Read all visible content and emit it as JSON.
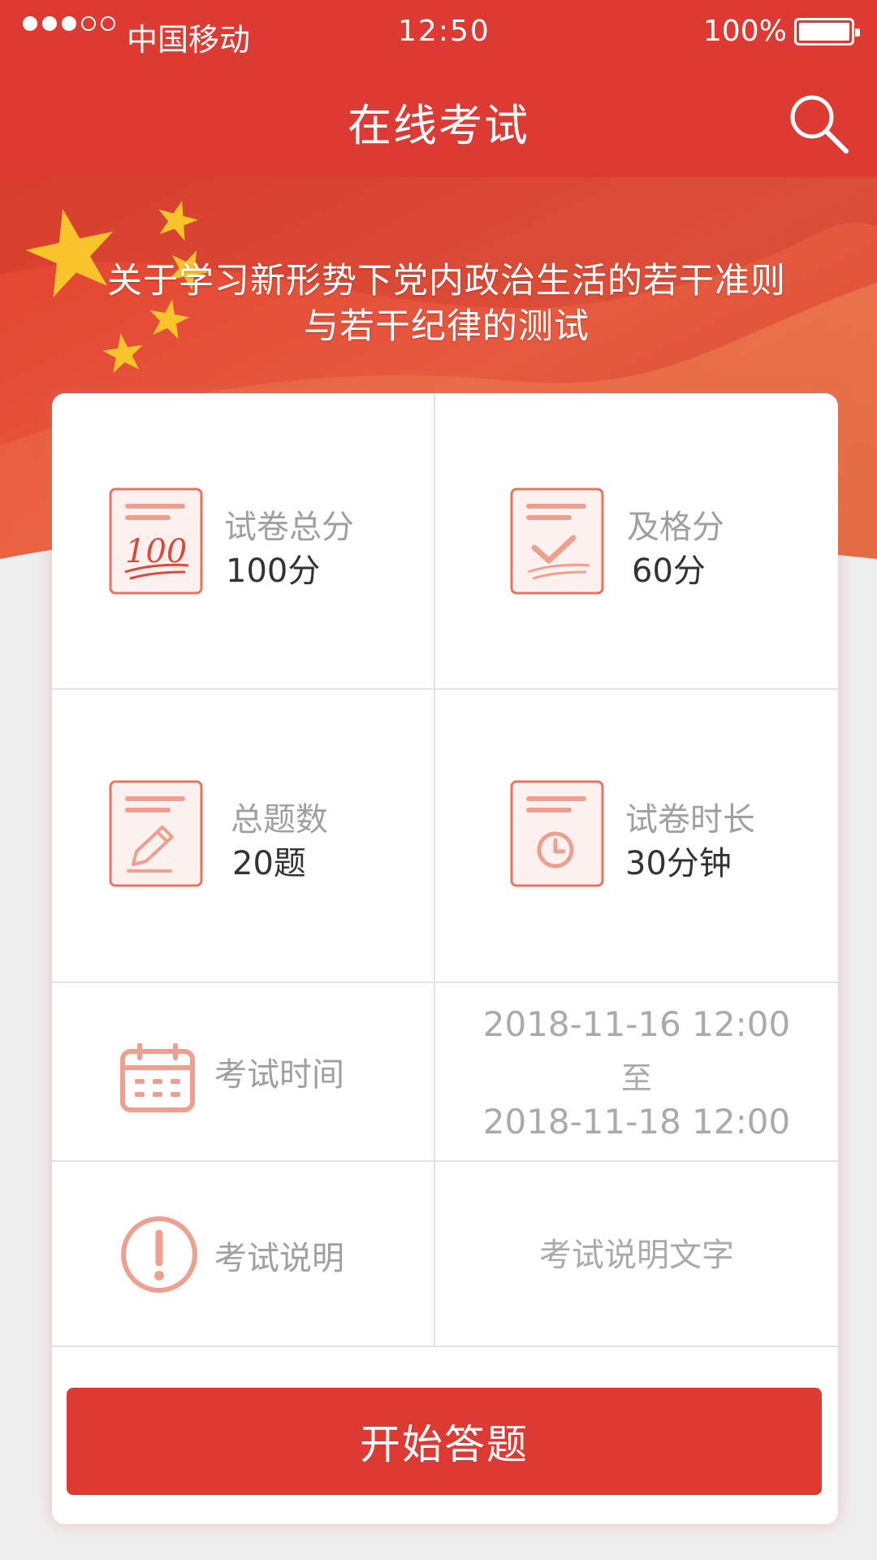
{
  "status_bar": {
    "carrier": "中国移动",
    "time": "12:50",
    "battery": "100%"
  },
  "header": {
    "title": "在线考试",
    "search_icon": "search-icon"
  },
  "banner": {
    "title_line1": "关于学习新形势下党内政治生活的若干准则",
    "title_line2": "与若干纪律的测试"
  },
  "stats": {
    "total_score": {
      "label": "试卷总分",
      "value": "100分",
      "icon": "score-100-icon"
    },
    "pass_score": {
      "label": "及格分",
      "value": "60分",
      "icon": "checkmark-paper-icon"
    },
    "question_count": {
      "label": "总题数",
      "value": "20题",
      "icon": "pencil-paper-icon"
    },
    "duration": {
      "label": "试卷时长",
      "value": "30分钟",
      "icon": "clock-paper-icon"
    }
  },
  "exam_time": {
    "label": "考试时间",
    "start": "2018-11-16 12:00",
    "separator": "至",
    "end": "2018-11-18 12:00",
    "icon": "calendar-icon"
  },
  "exam_note": {
    "label": "考试说明",
    "text": "考试说明文字",
    "icon": "exclamation-circle-icon"
  },
  "start_button": {
    "label": "开始答题"
  },
  "colors": {
    "primary": "#dc3a33",
    "icon_stroke": "#e8735f",
    "icon_fill": "#fdf1ef",
    "divider": "#e4e4e4",
    "label_gray": "#a0a0a0"
  }
}
